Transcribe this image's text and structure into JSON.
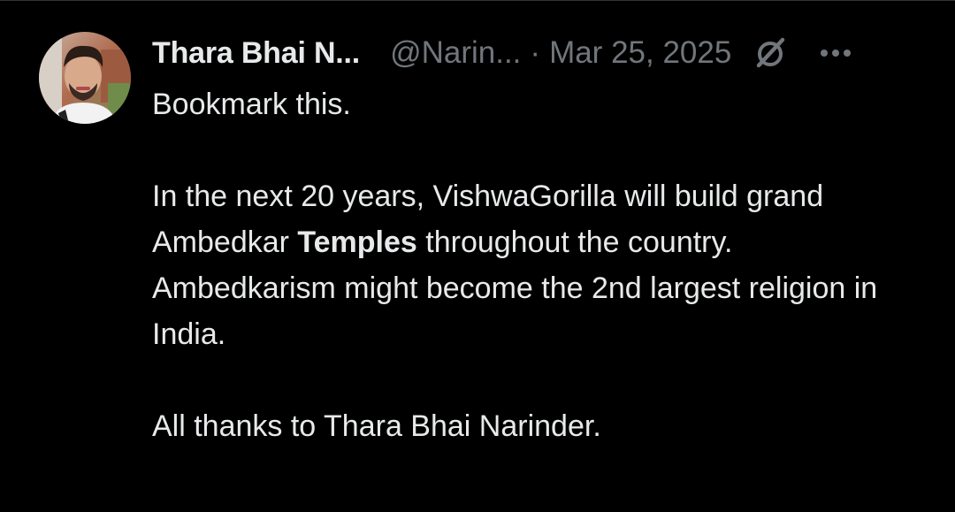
{
  "tweet": {
    "author": {
      "display_name": "Thara Bhai N...",
      "handle": "@Narin...",
      "avatar_icon": "profile-photo"
    },
    "separator": "·",
    "date": "Mar 25, 2025",
    "icons": {
      "grok": "grok-icon",
      "more": "more-icon"
    },
    "text": {
      "line1": "Bookmark this.",
      "para2_before": "In the next 20 years, VishwaGorilla will build grand Ambedkar ",
      "para2_bold": "Temples",
      "para2_after": " throughout the country.",
      "para3": "Ambedkarism might become the 2nd largest religion in India.",
      "para4": "All thanks to Thara Bhai Narinder."
    }
  },
  "colors": {
    "background": "#000000",
    "text_primary": "#e7e9ea",
    "text_secondary": "#71767b"
  }
}
